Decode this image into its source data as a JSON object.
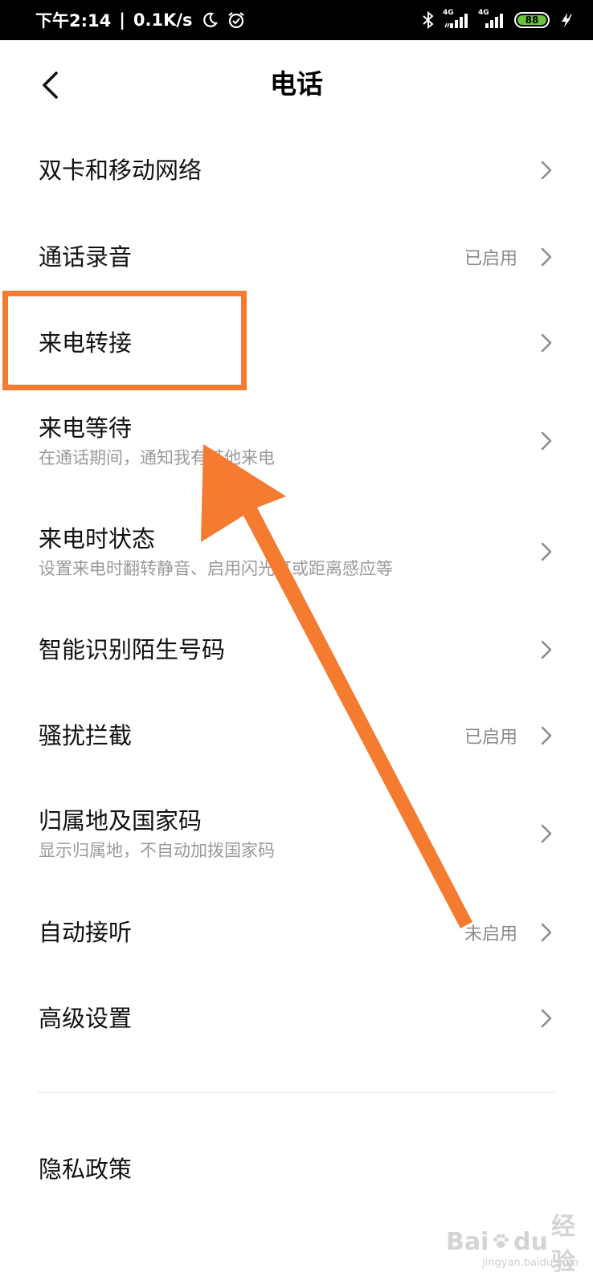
{
  "status_bar": {
    "time": "下午2:14",
    "separator": "|",
    "speed": "0.1K/s",
    "network_1": "4G",
    "network_2": "4G",
    "battery": "88"
  },
  "header": {
    "title": "电话"
  },
  "rows": [
    {
      "title": "双卡和移动网络",
      "subtitle": "",
      "value": ""
    },
    {
      "title": "通话录音",
      "subtitle": "",
      "value": "已启用"
    },
    {
      "title": "来电转接",
      "subtitle": "",
      "value": ""
    },
    {
      "title": "来电等待",
      "subtitle": "在通话期间，通知我有其他来电",
      "value": ""
    },
    {
      "title": "来电时状态",
      "subtitle": "设置来电时翻转静音、启用闪光灯或距离感应等",
      "value": ""
    },
    {
      "title": "智能识别陌生号码",
      "subtitle": "",
      "value": ""
    },
    {
      "title": "骚扰拦截",
      "subtitle": "",
      "value": "已启用"
    },
    {
      "title": "归属地及国家码",
      "subtitle": "显示归属地，不自动加拨国家码",
      "value": ""
    },
    {
      "title": "自动接听",
      "subtitle": "",
      "value": "未启用"
    },
    {
      "title": "高级设置",
      "subtitle": "",
      "value": ""
    },
    {
      "title": "隐私政策",
      "subtitle": "",
      "value": ""
    }
  ],
  "watermark": {
    "brand": "Bai",
    "brand2": "du",
    "suffix": "经验",
    "url": "jingyan.baidu.com"
  },
  "colors": {
    "annotation": "#f47b30",
    "battery": "#6cc33a"
  }
}
